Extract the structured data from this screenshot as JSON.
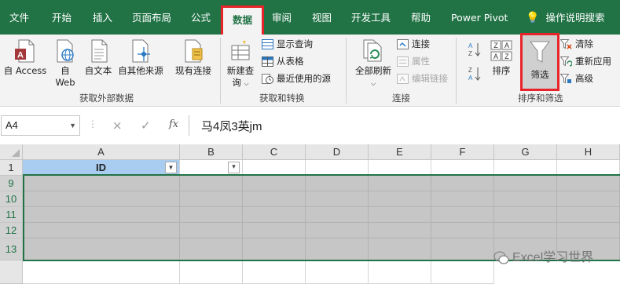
{
  "tabs": [
    "文件",
    "开始",
    "插入",
    "页面布局",
    "公式",
    "数据",
    "审阅",
    "视图",
    "开发工具",
    "帮助",
    "Power Pivot",
    "操作说明搜索"
  ],
  "active_tab": "数据",
  "ribbon": {
    "get_external": {
      "label": "获取外部数据",
      "access": "自 Access",
      "web_1": "自",
      "web_2": "Web",
      "text": "自文本",
      "other": "自其他来源",
      "existing": "现有连接"
    },
    "transform": {
      "label": "获取和转换",
      "new_query_1": "新建查",
      "new_query_2": "询",
      "show_queries": "显示查询",
      "from_table": "从表格",
      "recent_sources": "最近使用的源"
    },
    "connections": {
      "label": "连接",
      "refresh_all_1": "全部刷新",
      "connections": "连接",
      "properties": "属性",
      "edit_links": "编辑链接"
    },
    "sort_filter": {
      "label": "排序和筛选",
      "sort": "排序",
      "filter": "筛选",
      "clear": "清除",
      "reapply": "重新应用",
      "advanced": "高级"
    }
  },
  "formula_bar": {
    "name_box": "A4",
    "cancel": "×",
    "enter": "✓",
    "fx": "fx",
    "value": "马4凤3英jm"
  },
  "grid": {
    "columns": [
      "A",
      "B",
      "C",
      "D",
      "E",
      "F",
      "G",
      "H"
    ],
    "rows": [
      "1",
      "9",
      "10",
      "11",
      "12",
      "13"
    ],
    "header_cell": "ID"
  },
  "watermark": "Excel学习世界",
  "colors": {
    "accent": "#217346",
    "highlight": "#e8242a",
    "selected_header": "#a8cdf0"
  }
}
